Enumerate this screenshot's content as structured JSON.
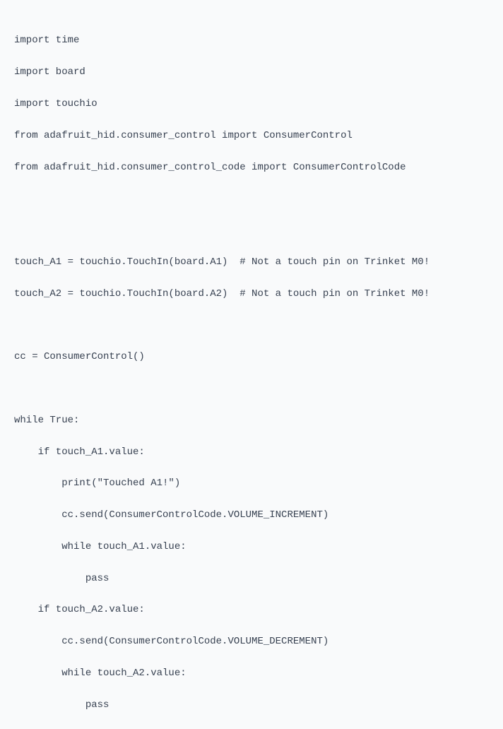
{
  "code": {
    "lines": [
      "import time",
      "import board",
      "import touchio",
      "from adafruit_hid.consumer_control import ConsumerControl",
      "from adafruit_hid.consumer_control_code import ConsumerControlCode",
      "",
      "",
      "touch_A1 = touchio.TouchIn(board.A1)  # Not a touch pin on Trinket M0!",
      "touch_A2 = touchio.TouchIn(board.A2)  # Not a touch pin on Trinket M0!",
      "",
      "cc = ConsumerControl()",
      "",
      "while True:",
      "    if touch_A1.value:",
      "        print(\"Touched A1!\")",
      "        cc.send(ConsumerControlCode.VOLUME_INCREMENT)",
      "        while touch_A1.value:",
      "            pass",
      "    if touch_A2.value:",
      "        cc.send(ConsumerControlCode.VOLUME_DECREMENT)",
      "        while touch_A2.value:",
      "            pass"
    ]
  }
}
